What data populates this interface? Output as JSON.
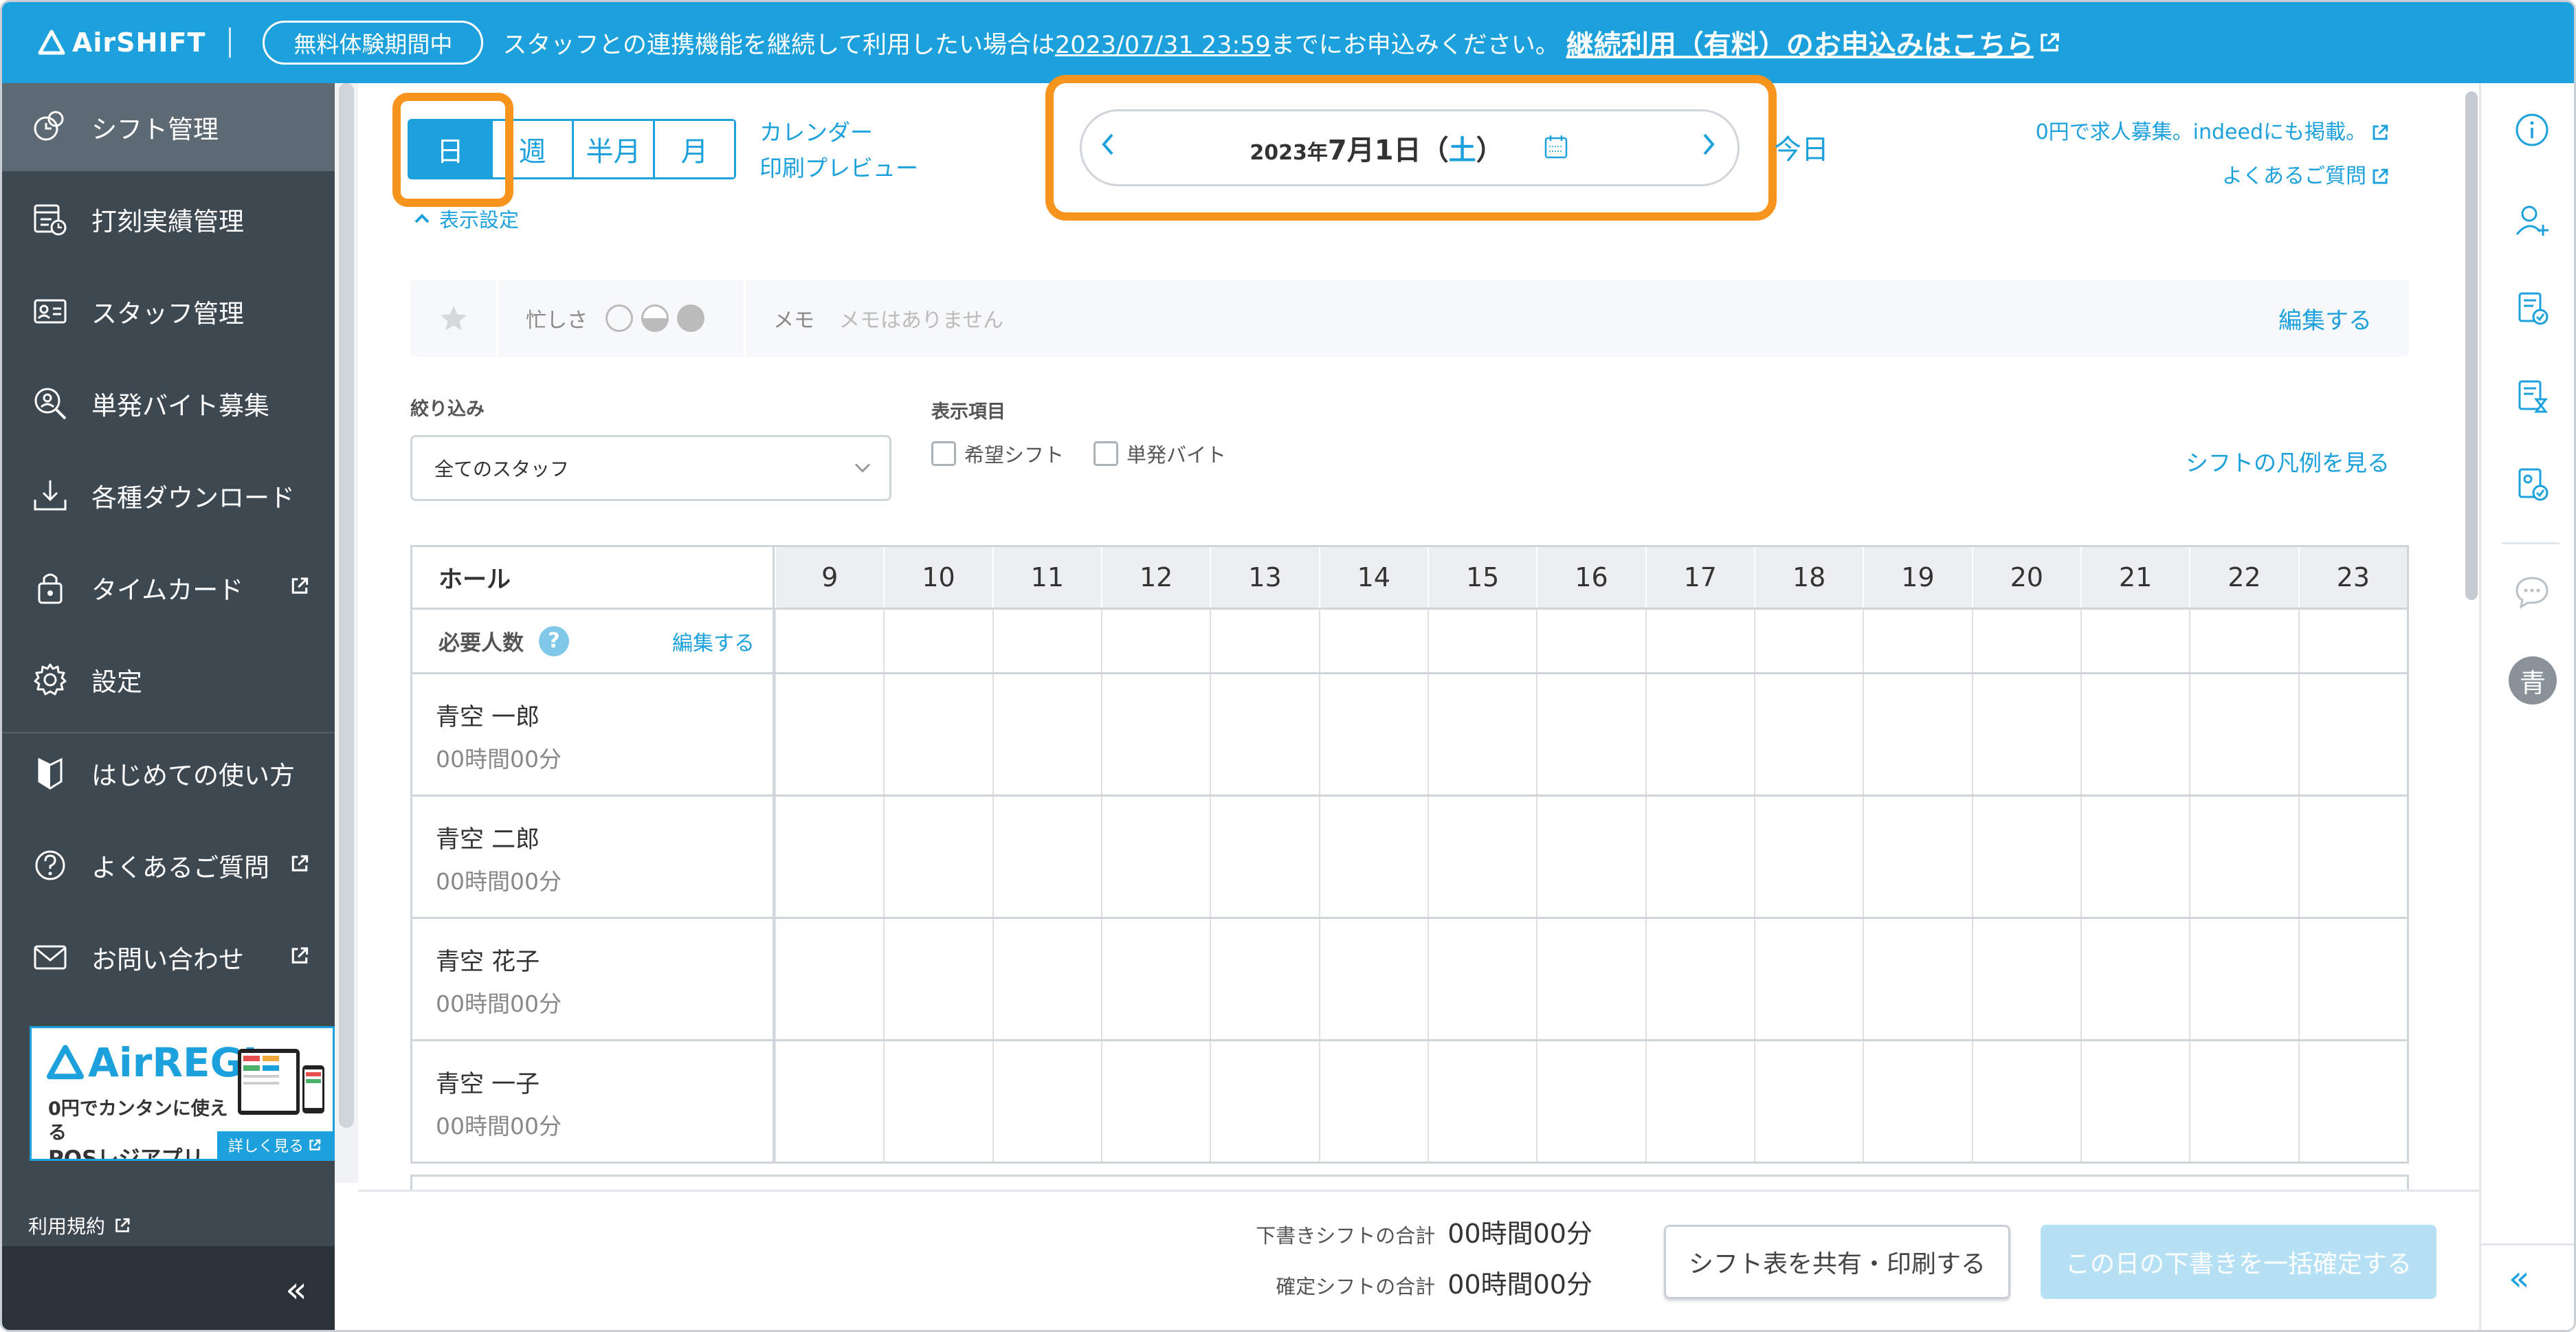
{
  "banner": {
    "logo_text": "AirSHIFT",
    "trial_badge": "無料体験期間中",
    "message_before": "スタッフとの連携機能を継続して利用したい場合は",
    "deadline": "2023/07/31 23:59",
    "message_after": "までにお申込みください。",
    "cta": "継続利用（有料）のお申込みはこちら"
  },
  "sidebar": {
    "items": [
      {
        "label": "シフト管理",
        "icon": "shift-icon"
      },
      {
        "label": "打刻実績管理",
        "icon": "time-record-icon"
      },
      {
        "label": "スタッフ管理",
        "icon": "staff-card-icon"
      },
      {
        "label": "単発バイト募集",
        "icon": "search-person-icon"
      },
      {
        "label": "各種ダウンロード",
        "icon": "download-icon"
      },
      {
        "label": "タイムカード",
        "icon": "lock-icon"
      },
      {
        "label": "設定",
        "icon": "gear-icon"
      },
      {
        "label": "はじめての使い方",
        "icon": "beginner-mark-icon"
      },
      {
        "label": "よくあるご質問",
        "icon": "question-icon"
      },
      {
        "label": "お問い合わせ",
        "icon": "mail-icon"
      }
    ],
    "ad": {
      "logo": "AirREGI",
      "line1": "0円でカンタンに使える",
      "line2": "POSレジアプリ",
      "more": "詳しく見る"
    },
    "terms": "利用規約",
    "collapse": "«"
  },
  "main": {
    "view_tabs": [
      "日",
      "週",
      "半月",
      "月"
    ],
    "links": [
      "カレンダー",
      "印刷プレビュー"
    ],
    "display_settings": "表示設定",
    "date": {
      "year": "2023年",
      "monthday": "7月1日",
      "open": "（",
      "weekday": "土",
      "close": "）"
    },
    "today": "今日",
    "top_links": [
      "0円で求人募集。indeedにも掲載。",
      "よくあるご質問"
    ],
    "memo_bar": {
      "busy_label": "忙しさ",
      "memo_label": "メモ",
      "memo_value": "メモはありません",
      "edit": "編集する"
    },
    "filter": {
      "label": "絞り込み",
      "selected": "全てのスタッフ"
    },
    "display_items": {
      "label": "表示項目",
      "options": [
        "希望シフト",
        "単発バイト"
      ]
    },
    "legend_link": "シフトの凡例を見る",
    "grid": {
      "group": "ホール",
      "hours": [
        "9",
        "10",
        "11",
        "12",
        "13",
        "14",
        "15",
        "16",
        "17",
        "18",
        "19",
        "20",
        "21",
        "22",
        "23"
      ],
      "required_label": "必要人数",
      "help": "?",
      "required_edit": "編集する",
      "staff": [
        {
          "name": "青空 一郎",
          "hours": "00時間00分"
        },
        {
          "name": "青空 二郎",
          "hours": "00時間00分"
        },
        {
          "name": "青空 花子",
          "hours": "00時間00分"
        },
        {
          "name": "青空 一子",
          "hours": "00時間00分"
        }
      ]
    }
  },
  "footer": {
    "draft_label": "下書きシフトの合計",
    "draft_value": "00時間00分",
    "confirmed_label": "確定シフトの合計",
    "confirmed_value": "00時間00分",
    "share_button": "シフト表を共有・印刷する",
    "confirm_button": "この日の下書きを一括確定する"
  },
  "rail": {
    "avatar": "青",
    "collapse": "«"
  },
  "colors": {
    "brand": "#1da1dc",
    "sidebar": "#3d4851",
    "highlight": "#f7941d"
  }
}
